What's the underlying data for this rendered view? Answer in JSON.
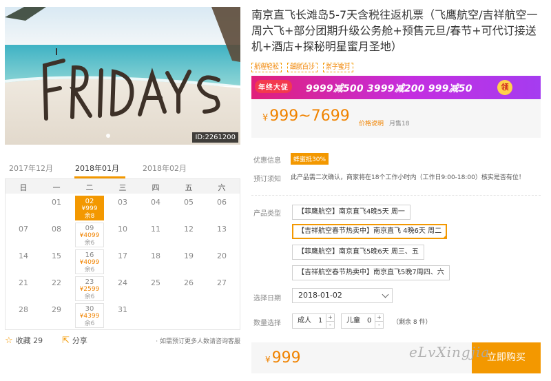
{
  "hero": {
    "image_text": "FRIDAYS",
    "product_id": "ID:2261200"
  },
  "calendar": {
    "months": [
      "2017年12月",
      "2018年01月",
      "2018年02月"
    ],
    "weekdays": [
      "日",
      "一",
      "二",
      "三",
      "四",
      "五",
      "六"
    ],
    "days": [
      "01",
      "02",
      "03",
      "04",
      "05",
      "06",
      "07",
      "08",
      "09",
      "10",
      "11",
      "12",
      "13",
      "14",
      "15",
      "16",
      "17",
      "18",
      "19",
      "20",
      "21",
      "22",
      "23",
      "24",
      "25",
      "26",
      "27",
      "28",
      "29",
      "30",
      "31"
    ],
    "available": [
      {
        "date": "02",
        "price": "¥999",
        "stock": "余8"
      },
      {
        "date": "09",
        "price": "¥4099",
        "stock": "余6"
      },
      {
        "date": "16",
        "price": "¥4099",
        "stock": "余6"
      },
      {
        "date": "23",
        "price": "¥2599",
        "stock": "余6"
      },
      {
        "date": "30",
        "price": "¥4399",
        "stock": "余6"
      }
    ]
  },
  "social": {
    "favorite": "收藏 29",
    "share": "分享",
    "consult": "· 如需预订更多人数请咨询客服"
  },
  "product": {
    "title": "南京直飞长滩岛5-7天含税往返机票（飞鹰航空/吉祥航空一周六飞+部分团期升级公务舱+预售元旦/春节+可代订接送机+酒店+探秘明星蜜月圣地）",
    "tags": [
      "航程轻松",
      "细腻白沙",
      "亲子蜜月"
    ]
  },
  "banner": {
    "badge": "年终大促",
    "promo": "9999减500  3999减200  999减50",
    "coupon": "领"
  },
  "price": {
    "currency": "¥",
    "range": "999~7699",
    "explain": "价格说明",
    "sold": "月售18"
  },
  "info": {
    "promo_label": "优惠信息",
    "promo_badge": "蜂蜜抵30%",
    "notice_label": "预订须知",
    "notice": "此产品需二次确认，商家将在18个工作小时内（工作日9:00-18:00）核实是否有位！"
  },
  "options": {
    "label": "产品类型",
    "items": [
      "【菲鹰航空】南京直飞4晚5天 周一",
      "【吉祥航空春节热卖中】南京直飞 4晚6天 周二",
      "【菲鹰航空】南京直飞5晚6天 周三、五",
      "【吉祥航空春节热卖中】南京直飞5晚7周四、六"
    ],
    "selected_index": 1
  },
  "date": {
    "label": "选择日期",
    "value": "2018-01-02"
  },
  "quantity": {
    "label": "数量选择",
    "adult_label": "成人",
    "adult_value": "1",
    "child_label": "儿童",
    "child_value": "0",
    "remain": "（剩余 8 件）",
    "plus": "+",
    "minus": "-"
  },
  "purchase": {
    "currency": "¥",
    "price": "999",
    "button": "立即购买"
  },
  "watermark": "eLvXingjia",
  "colors": {
    "accent": "#f39800",
    "price": "#f08300",
    "banner": "#c42ee0"
  }
}
